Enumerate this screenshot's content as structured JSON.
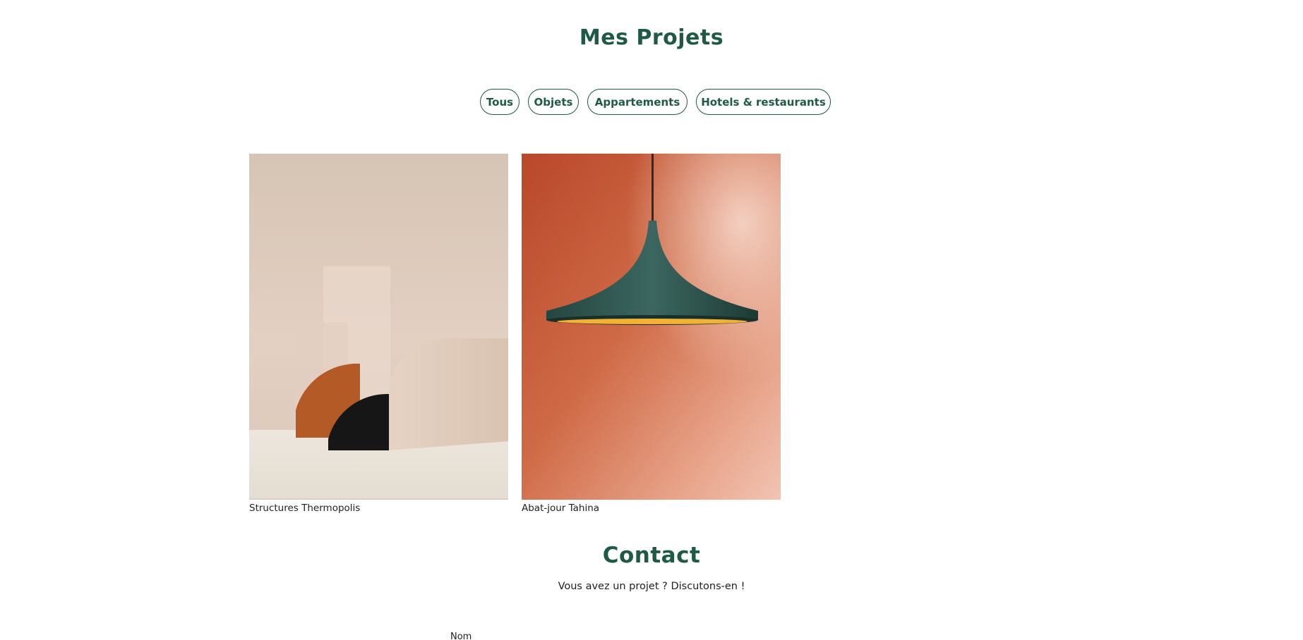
{
  "projects": {
    "title": "Mes Projets",
    "filters": [
      "Tous",
      "Objets",
      "Appartements",
      "Hotels & restaurants"
    ]
  },
  "cards": [
    {
      "caption": "Structures Thermopolis",
      "image": "abstract-arches-sculpture"
    },
    {
      "caption": "Abat-jour Tahina",
      "image": "pendant-lamp-on-orange-wall"
    }
  ],
  "contact": {
    "title": "Contact",
    "subtitle": "Vous avez un projet ? Discutons-en !",
    "form": {
      "name_label": "Nom"
    }
  },
  "colors": {
    "accent": "#1f5a46",
    "text": "#222222",
    "background": "#ffffff"
  }
}
